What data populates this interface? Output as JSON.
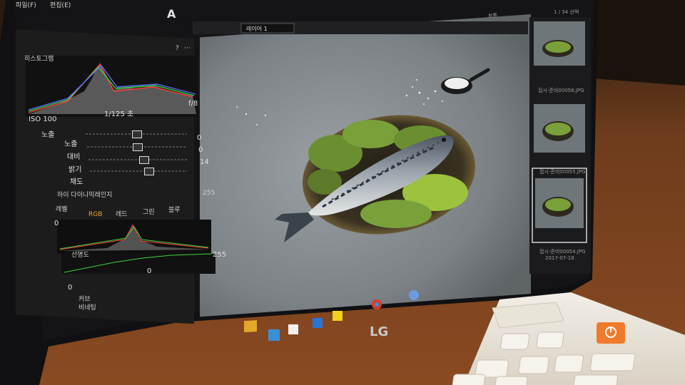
{
  "menu": {
    "file": "파일(F)",
    "edit": "편집(E)"
  },
  "toolbar": {
    "text_tool": "A"
  },
  "panels": {
    "histogram": {
      "title": "히스토그램",
      "iso": "ISO 100",
      "shutter": "1/125 초",
      "aperture": "f/8",
      "help": "?",
      "more": "···"
    },
    "exposure": {
      "title": "노출",
      "sliders": [
        {
          "label": "노출",
          "value": "0",
          "level": 0.5
        },
        {
          "label": "대비",
          "value": "0",
          "level": 0.5
        },
        {
          "label": "밝기",
          "value": "14",
          "level": 0.56
        },
        {
          "label": "채도",
          "value": "",
          "level": 0.6
        }
      ]
    },
    "hdr": {
      "title": "하이 다이나믹레인지",
      "max": "255"
    },
    "levels": {
      "title": "레벨",
      "tabs": [
        "RGB",
        "레드",
        "그린",
        "블루"
      ],
      "left": "0",
      "right": "255",
      "mid": "0",
      "bottom_left": "0"
    },
    "sharpness": {
      "title": "선명도"
    },
    "curve": {
      "title": "커브"
    },
    "vignette": {
      "title": "비네팅"
    }
  },
  "viewer": {
    "layer_select": "레이어 1"
  },
  "filmstrip": {
    "top_label": "보통",
    "count": "1 / 34 선택",
    "captions": [
      "접시-준비00056.JPG",
      "접시-준비00055.JPG",
      "접시-준비00054.JPG"
    ],
    "date": "2017-07-18"
  },
  "laptop": {
    "brand": "LG"
  },
  "colors": {
    "accent": "#e3a72b",
    "power_key": "#f07a2c",
    "panel_bg": "#1c1c1c",
    "table": "#6b3a1c"
  }
}
